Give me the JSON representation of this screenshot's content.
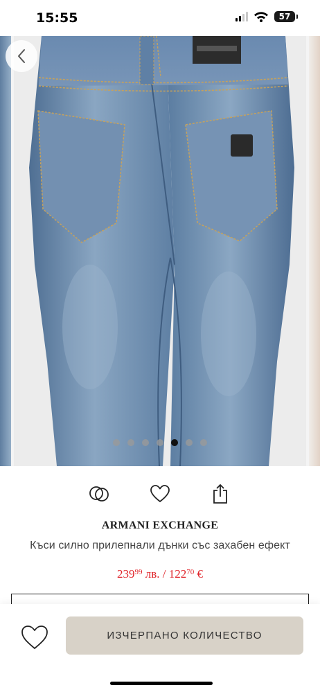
{
  "status_bar": {
    "time": "15:55",
    "battery": "57"
  },
  "gallery": {
    "slide_count": 7,
    "active_slide": 5
  },
  "actions": {
    "compare_icon": "compare-rings-icon",
    "favorite_icon": "heart-icon",
    "share_icon": "share-icon"
  },
  "product": {
    "brand": "ARMANI EXCHANGE",
    "name": "Къси силно прилепнали дънки със захабен ефект",
    "price": {
      "bgn_main": "239",
      "bgn_cents": "99",
      "bgn_currency": "лв.",
      "separator": "/",
      "eur_main": "122",
      "eur_cents": "70",
      "eur_currency": "€"
    }
  },
  "bottom_bar": {
    "sold_out_label": "ИЗЧЕРПАНО КОЛИЧЕСТВО",
    "favorite_icon": "heart-icon"
  },
  "colors": {
    "price_red": "#e0242a",
    "button_beige": "#d8d2c8",
    "denim": "#6f8eae"
  }
}
